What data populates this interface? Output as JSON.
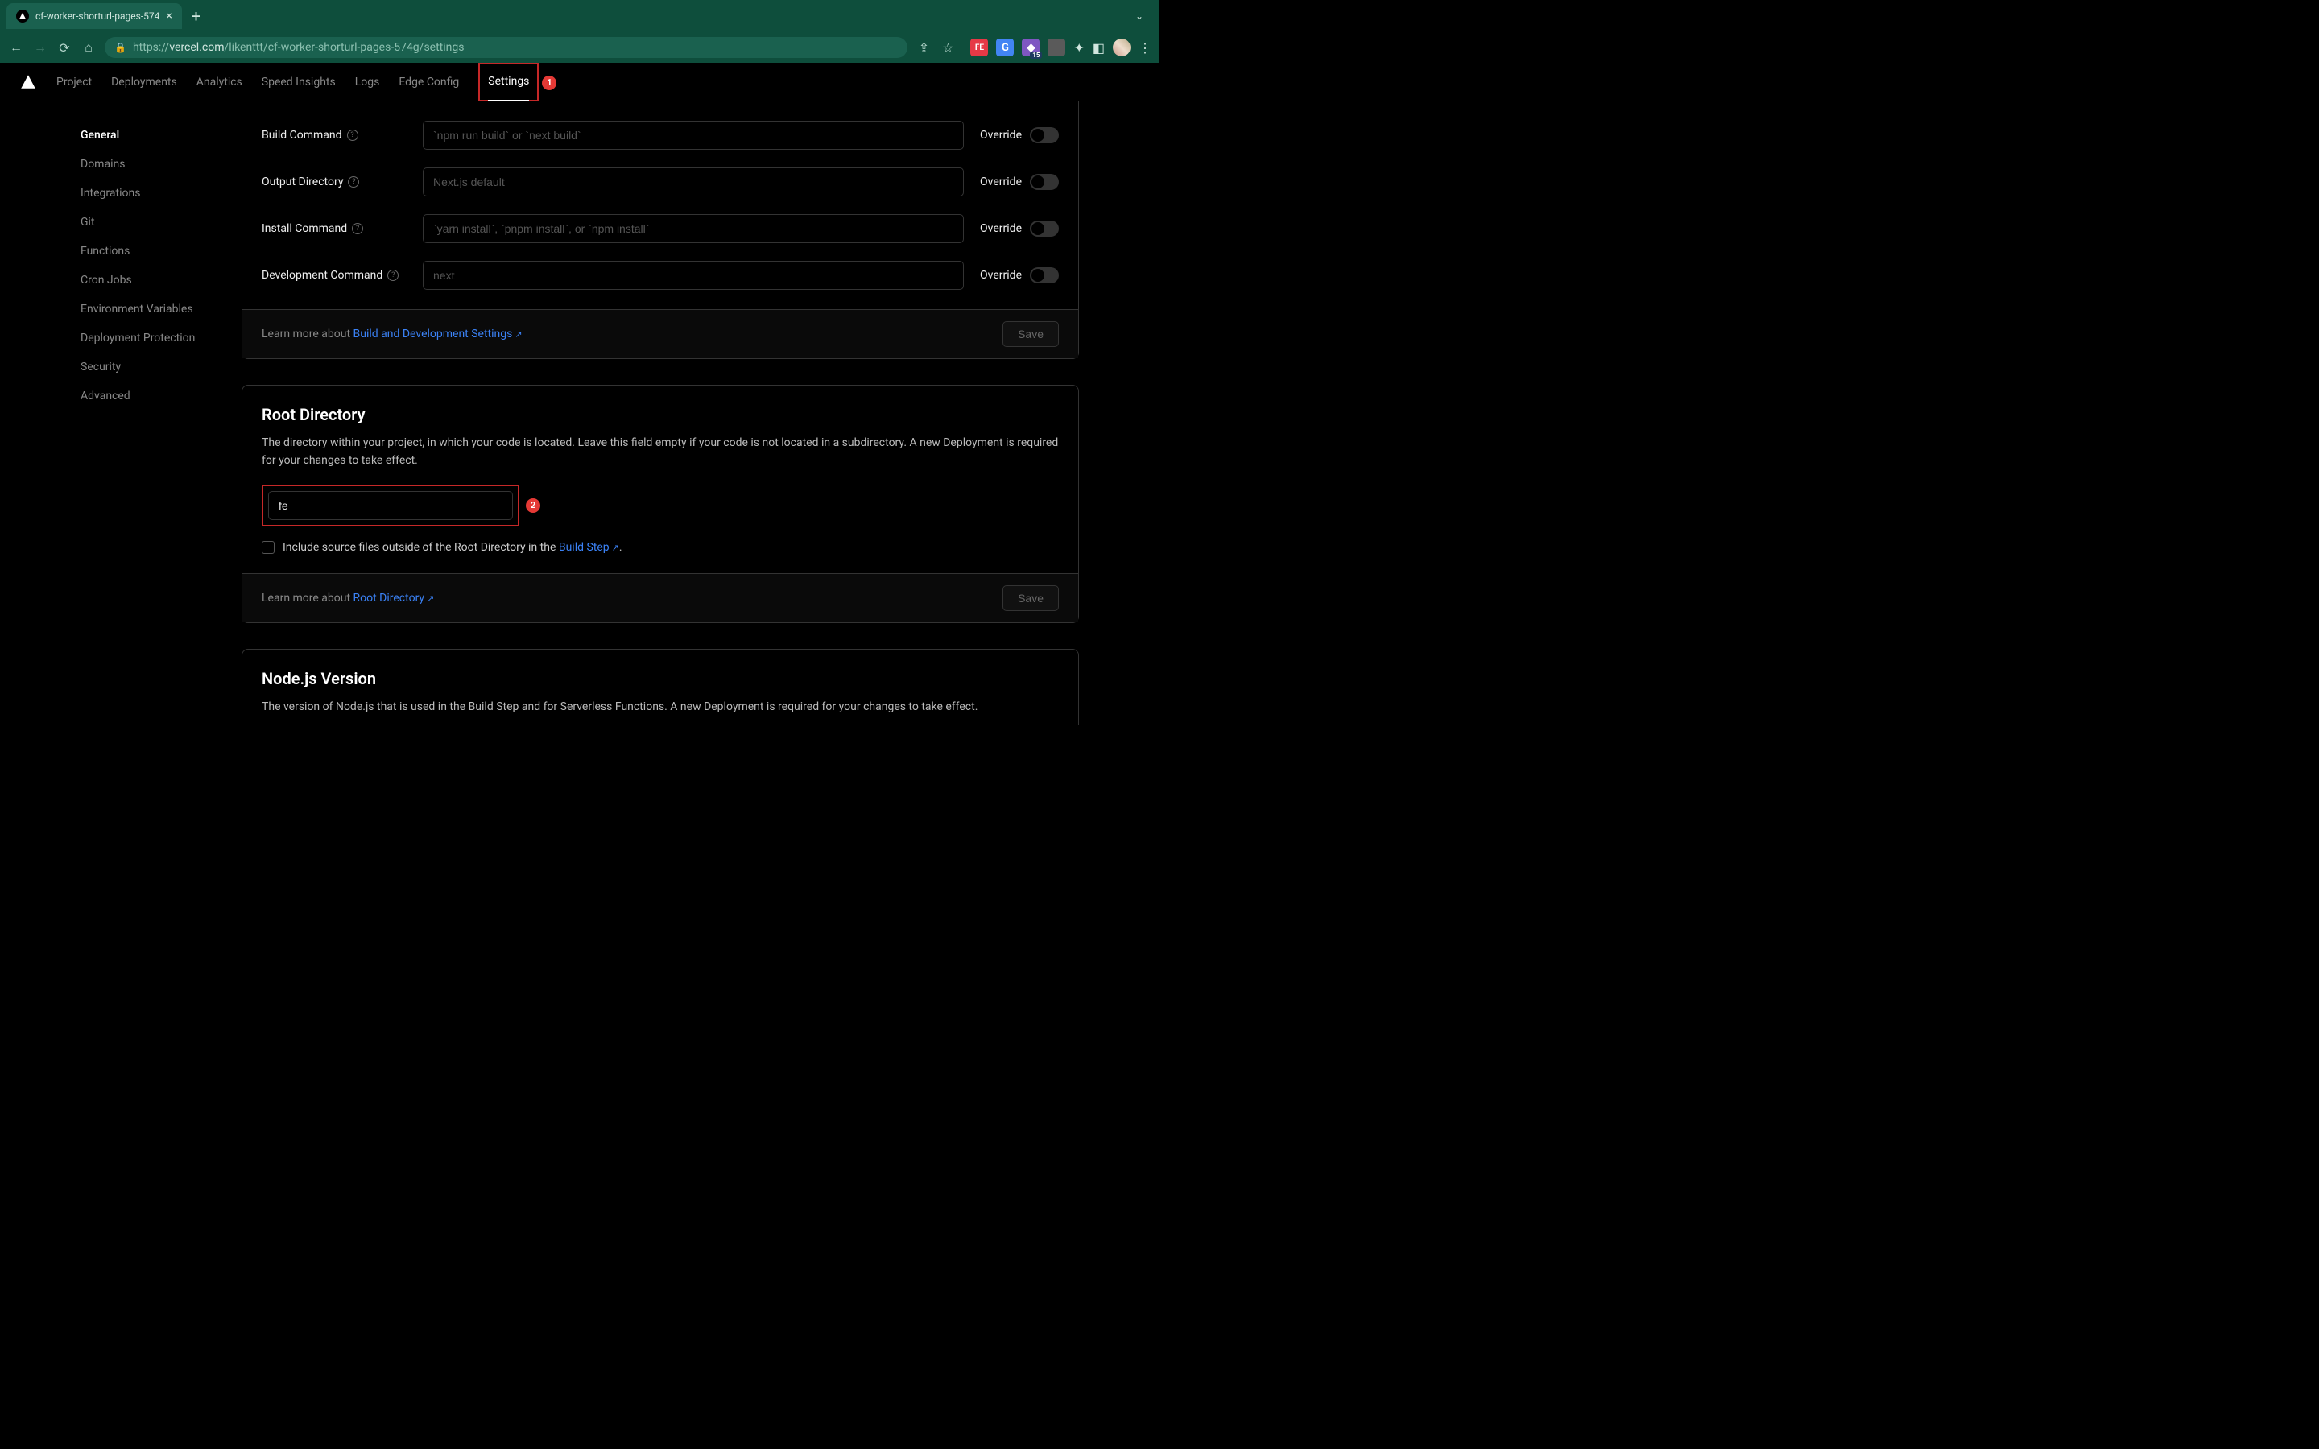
{
  "browser": {
    "tab_title": "cf-worker-shorturl-pages-574",
    "url_display": "https://vercel.com/likenttt/cf-worker-shorturl-pages-574g/settings",
    "url_host_prefix": "https://",
    "url_host": "vercel.com",
    "url_path": "/likenttt/cf-worker-shorturl-pages-574g/settings"
  },
  "topnav": {
    "items": [
      "Project",
      "Deployments",
      "Analytics",
      "Speed Insights",
      "Logs",
      "Edge Config",
      "Settings"
    ],
    "active": "Settings"
  },
  "annotations": {
    "one": "1",
    "two": "2"
  },
  "sidebar": {
    "items": [
      "General",
      "Domains",
      "Integrations",
      "Git",
      "Functions",
      "Cron Jobs",
      "Environment Variables",
      "Deployment Protection",
      "Security",
      "Advanced"
    ],
    "active": "General"
  },
  "build_section": {
    "rows": [
      {
        "label": "Build Command",
        "placeholder": "`npm run build` or `next build`",
        "value": ""
      },
      {
        "label": "Output Directory",
        "placeholder": "Next.js default",
        "value": ""
      },
      {
        "label": "Install Command",
        "placeholder": "`yarn install`, `pnpm install`, or `npm install`",
        "value": ""
      },
      {
        "label": "Development Command",
        "placeholder": "next",
        "value": ""
      }
    ],
    "override_label": "Override",
    "footer_text": "Learn more about ",
    "footer_link": "Build and Development Settings",
    "save_label": "Save"
  },
  "root_section": {
    "title": "Root Directory",
    "desc": "The directory within your project, in which your code is located. Leave this field empty if your code is not located in a subdirectory. A new Deployment is required for your changes to take effect.",
    "input_value": "fe",
    "checkbox_label_pre": "Include source files outside of the Root Directory in the ",
    "checkbox_link": "Build Step",
    "checkbox_label_post": ".",
    "footer_text": "Learn more about ",
    "footer_link": "Root Directory",
    "save_label": "Save"
  },
  "node_section": {
    "title": "Node.js Version",
    "desc": "The version of Node.js that is used in the Build Step and for Serverless Functions. A new Deployment is required for your changes to take effect."
  },
  "ext_badge": "15"
}
